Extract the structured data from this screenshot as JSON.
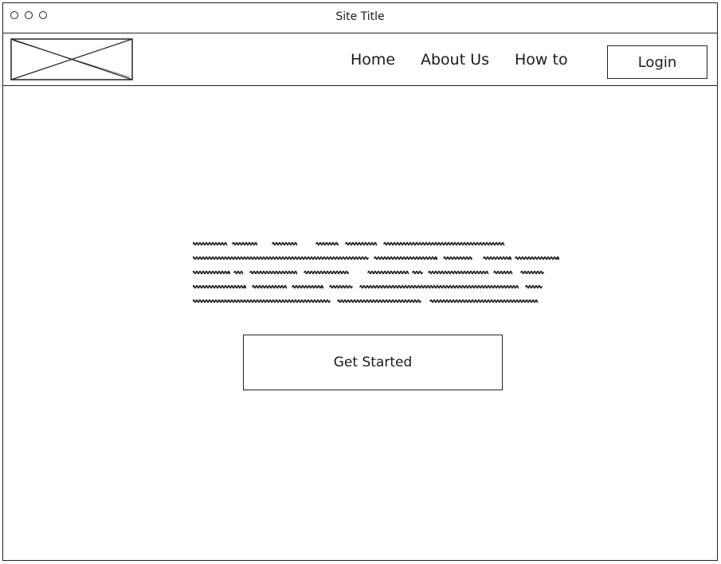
{
  "window": {
    "title": "Site Title"
  },
  "header": {
    "nav": [
      {
        "label": "Home"
      },
      {
        "label": "About Us"
      },
      {
        "label": "How to"
      }
    ],
    "login_label": "Login"
  },
  "hero": {
    "cta_label": "Get Started"
  }
}
